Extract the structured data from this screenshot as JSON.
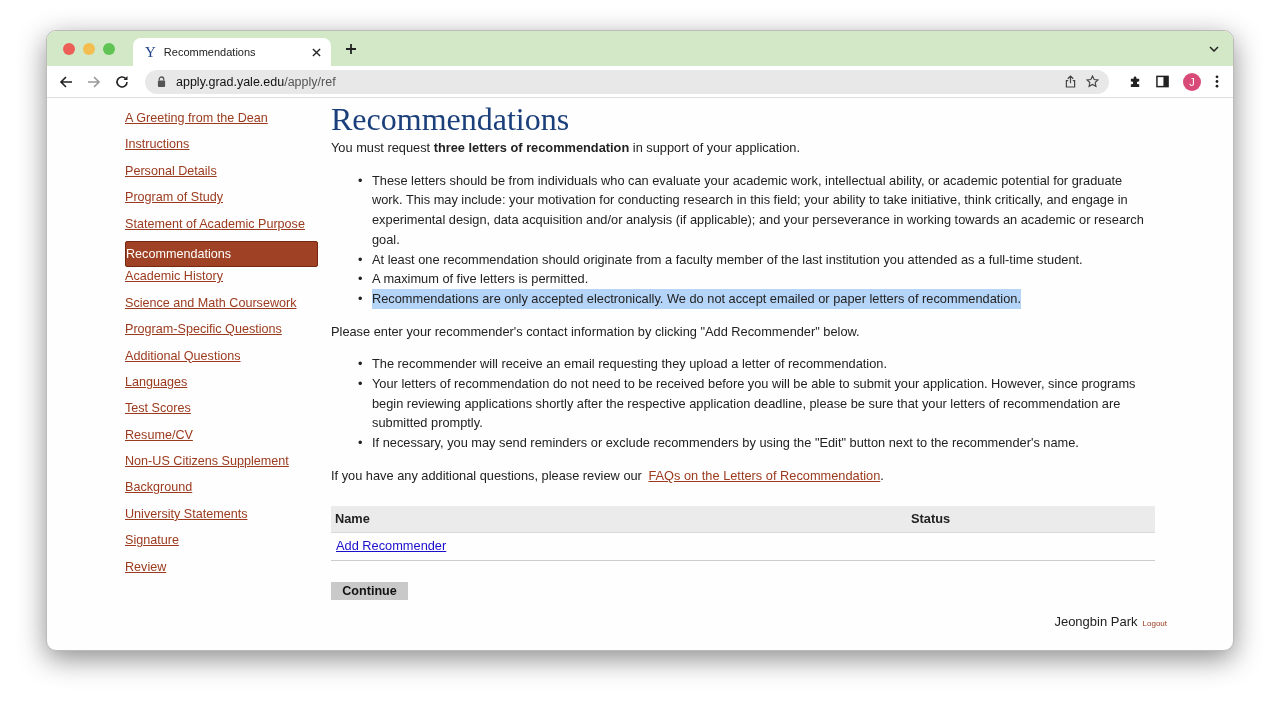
{
  "browser": {
    "tab": {
      "favicon_letter": "Y",
      "title": "Recommendations",
      "selected": true
    },
    "address": {
      "host": "apply.grad.yale.edu",
      "path": "/apply/ref"
    },
    "back_enabled": true,
    "forward_enabled": false,
    "avatar_letter": "J"
  },
  "sidebar": {
    "items": [
      {
        "label": "A Greeting from the Dean",
        "selected": false
      },
      {
        "label": "Instructions",
        "selected": false
      },
      {
        "label": "Personal Details",
        "selected": false
      },
      {
        "label": "Program of Study",
        "selected": false
      },
      {
        "label": "Statement of Academic Purpose",
        "selected": false
      },
      {
        "label": "Recommendations",
        "selected": true
      },
      {
        "label": "Academic History",
        "selected": false
      },
      {
        "label": "Science and Math Coursework",
        "selected": false
      },
      {
        "label": "Program-Specific Questions",
        "selected": false
      },
      {
        "label": "Additional Questions",
        "selected": false
      },
      {
        "label": "Languages",
        "selected": false
      },
      {
        "label": "Test Scores",
        "selected": false
      },
      {
        "label": "Resume/CV",
        "selected": false
      },
      {
        "label": "Non-US Citizens Supplement",
        "selected": false
      },
      {
        "label": "Background",
        "selected": false
      },
      {
        "label": "University Statements",
        "selected": false
      },
      {
        "label": "Signature",
        "selected": false
      },
      {
        "label": "Review",
        "selected": false
      }
    ]
  },
  "main": {
    "heading": "Recommendations",
    "intro": "You must request **three letters of recommendation** in support of your application.",
    "bullet_marker": "•",
    "bullets": [
      {
        "text": "These letters should be from individuals who can evaluate your academic work, intellectual ability, or academic potential for graduate work. This may include: your motivation for conducting research in this field; your ability to take initiative, think critically, and engage in experimental design, data acquisition and/or analysis (if applicable); and your perseverance in working towards an academic or research goal.",
        "highlighted": false
      },
      {
        "text": "At least one recommendation should originate from a faculty member of the last institution you attended as a full-time student.",
        "highlighted": false
      },
      {
        "text": "A maximum of five letters is permitted.",
        "highlighted": false
      },
      {
        "text": "Recommendations are only accepted electronically. We do not accept emailed or paper letters of recommendation.",
        "highlighted": true
      }
    ],
    "instruction": "Please enter your recommender's contact information by clicking \"Add Recommender\" below.",
    "bullets_2": [
      {
        "text": "The recommender will receive an email requesting they upload a letter of recommendation.",
        "highlighted": false
      },
      {
        "text": "Your letters of recommendation do not need to be received before you will be able to submit your application. However, since programs begin reviewing applications shortly after the respective application deadline, please be sure that your letters of recommendation are submitted promptly.",
        "highlighted": false
      },
      {
        "text": "If necessary, you may send reminders or exclude recommenders by using the \"Edit\" button next to the recommender's name.",
        "highlighted": false
      }
    ],
    "faq": {
      "before": "If you have any additional questions, please review our ",
      "link": "FAQs on the Letters of Recommendation",
      "after": "."
    },
    "table": {
      "columns": [
        "Name",
        "Status"
      ],
      "rows": [
        {
          "kind": "link",
          "text": "Add Recommender"
        }
      ]
    },
    "continue_button": "Continue",
    "footer": {
      "user": "Jeongbin Park",
      "logout": "Logout"
    }
  }
}
